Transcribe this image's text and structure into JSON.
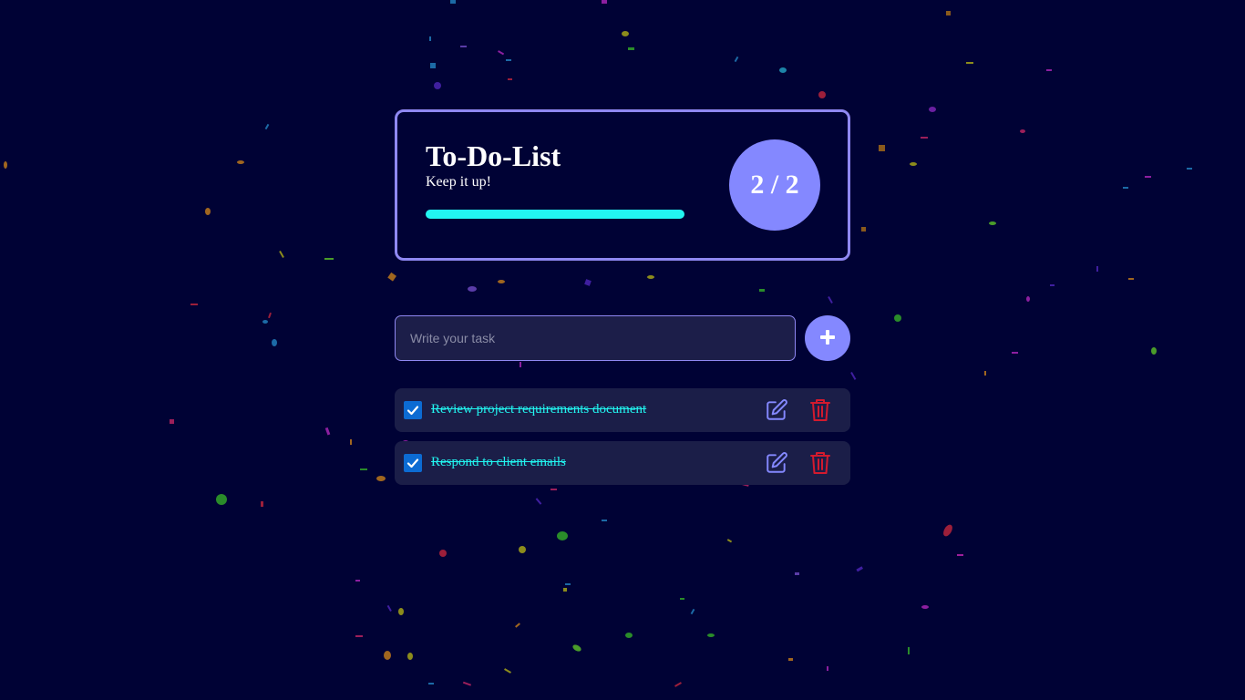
{
  "header": {
    "title": "To-Do-List",
    "subtitle": "Keep it up!",
    "progress_fraction": 1.0,
    "stats_text": "2 / 2"
  },
  "form": {
    "placeholder": "Write your task",
    "value": "",
    "add_icon": "plus-icon"
  },
  "tasks": [
    {
      "text": "Review project requirements document",
      "completed": true
    },
    {
      "text": "Respond to client emails",
      "completed": true
    }
  ],
  "colors": {
    "background": "#000235",
    "accent": "#8488ff",
    "border": "#8f88f2",
    "progress": "#22f5f0",
    "completed_text": "#22f5f0",
    "delete": "#d31a2e",
    "card": "#1b1e48",
    "checkbox": "#0c6bd3"
  },
  "icons": {
    "edit": "edit-icon",
    "delete": "trash-icon",
    "check": "check-icon"
  }
}
